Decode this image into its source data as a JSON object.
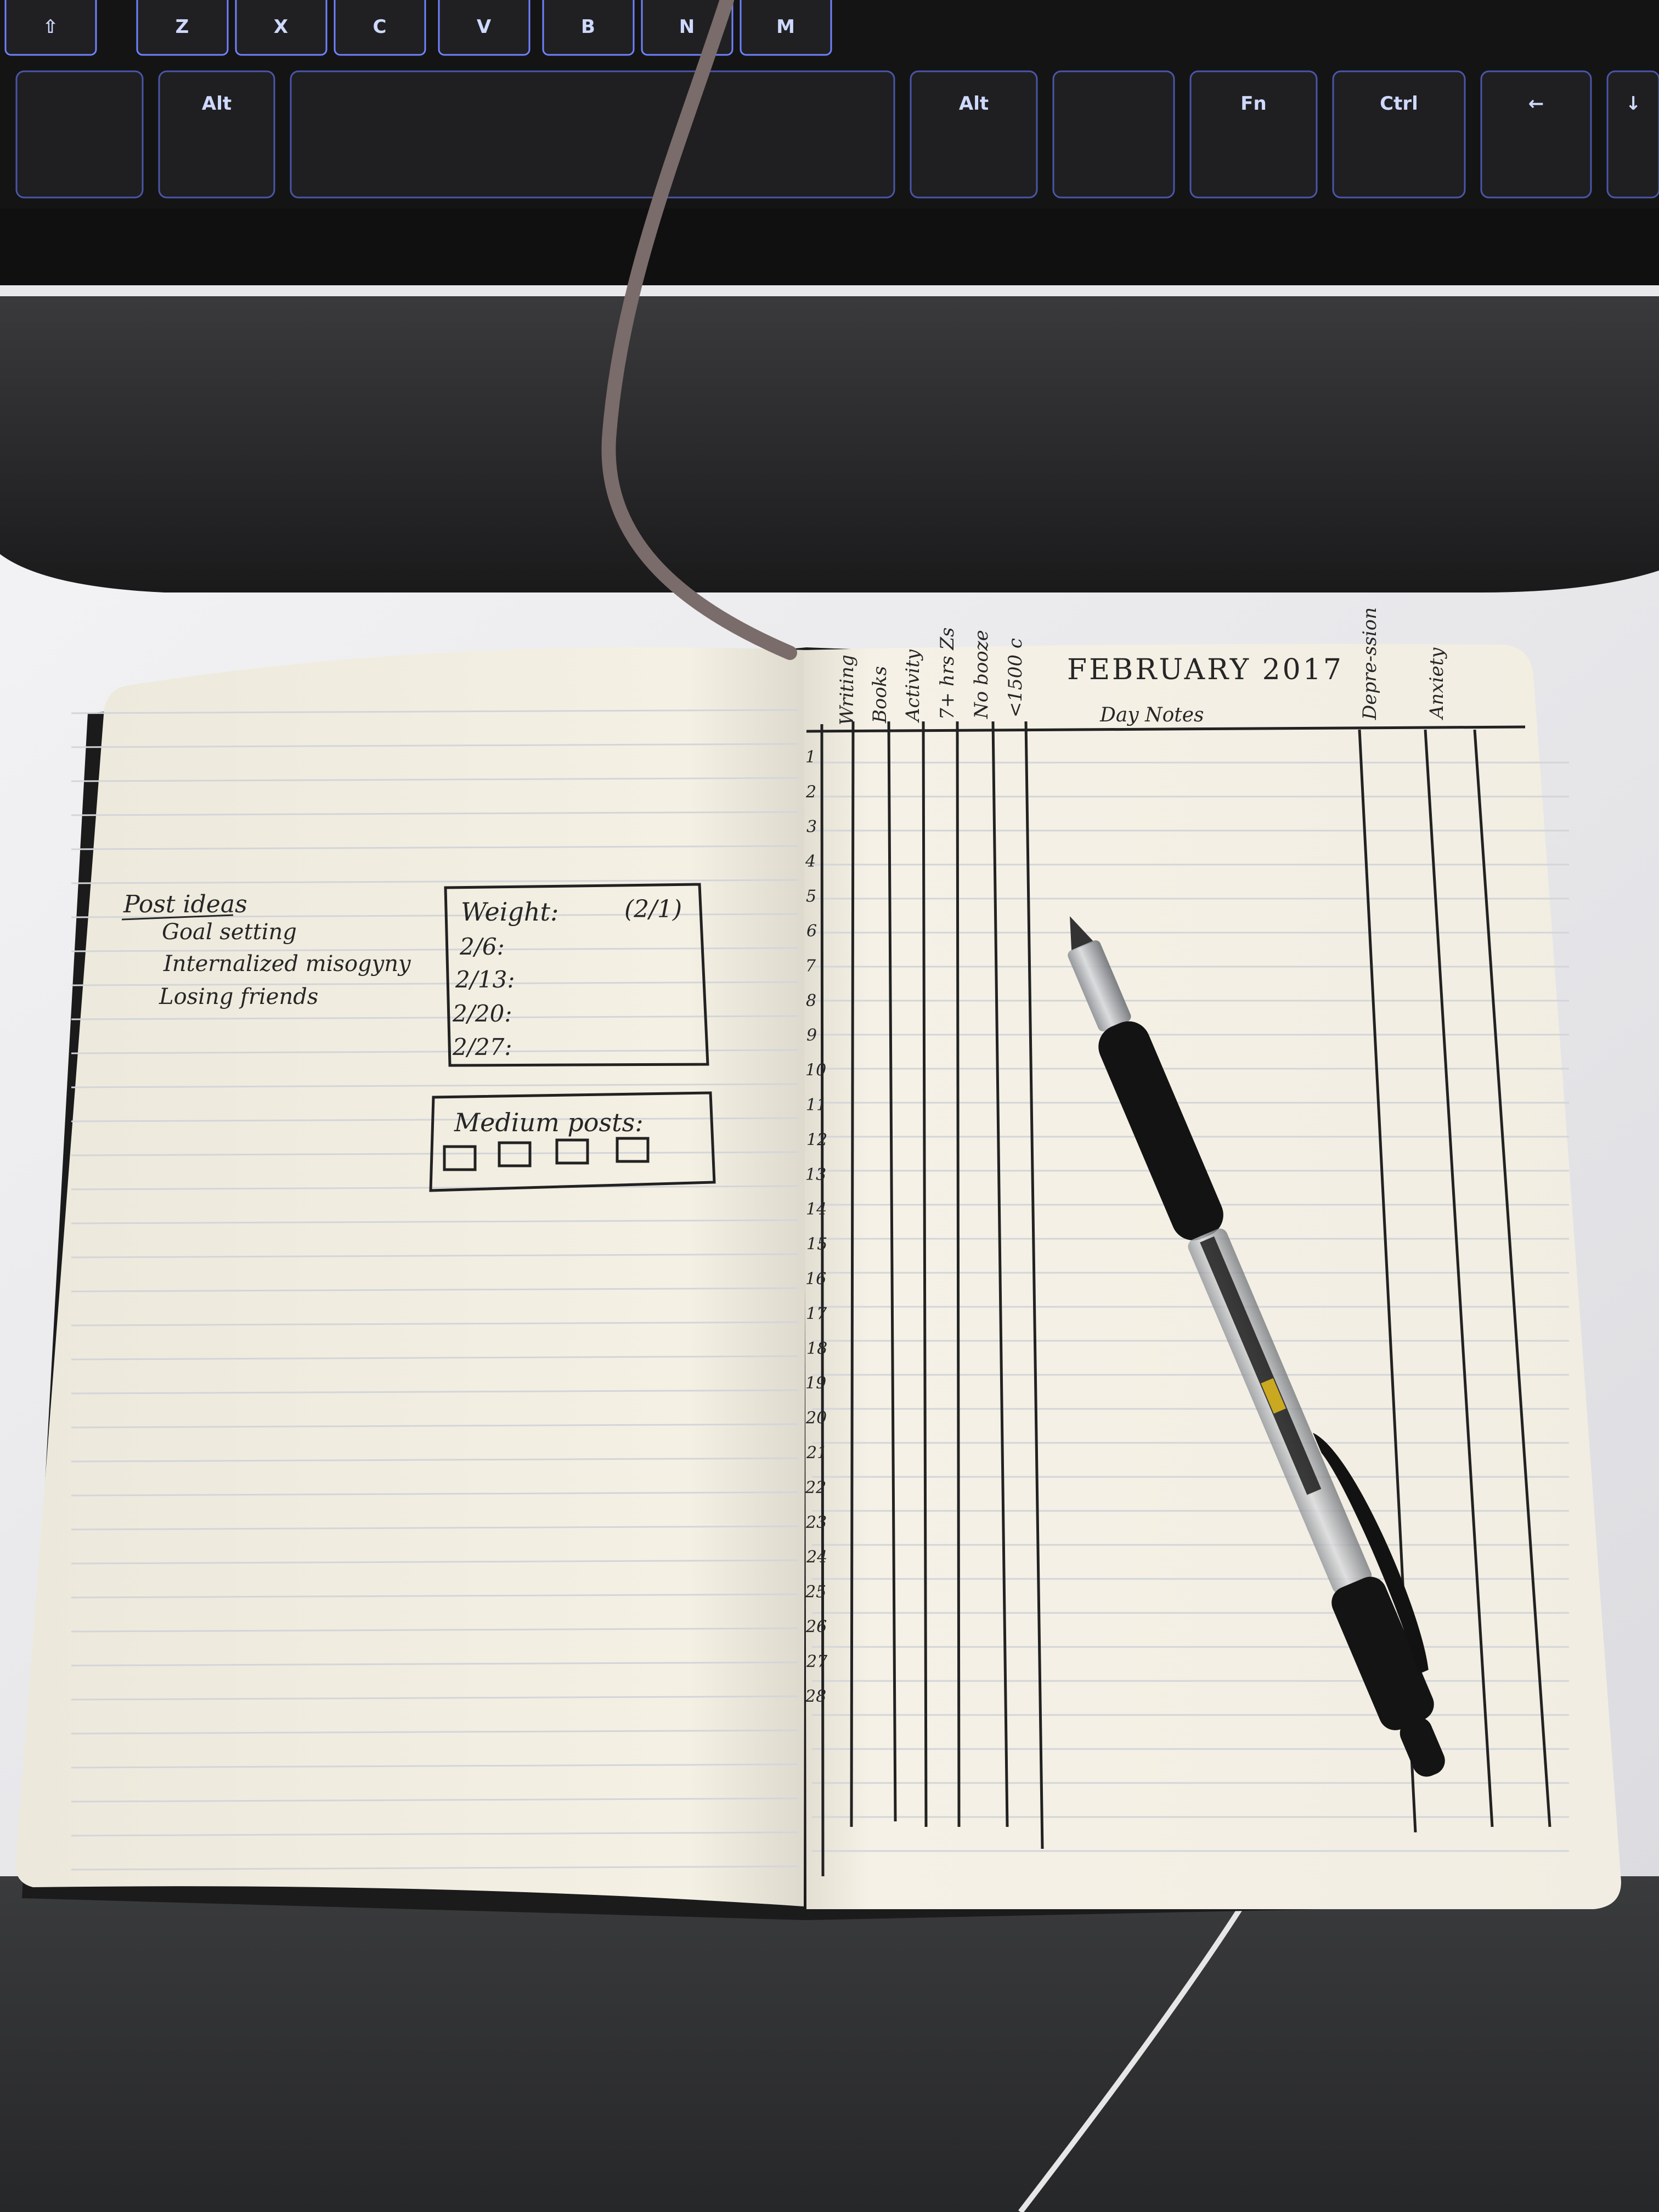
{
  "photo": {
    "description_colors": {
      "desk": "#ececef",
      "keyboard": "#1e1e20",
      "key_glow": "#7a8cff",
      "wrist_rest": "#2b2b2d",
      "paper": "#f4f0e4",
      "rule_line": "#d2d4d8",
      "ink": "#222222",
      "ribbon": "#7c6e6c",
      "floor": "#2c2d2f"
    }
  },
  "keyboard": {
    "top_keys": [
      "⇧",
      "Z",
      "X",
      "C",
      "V",
      "B",
      "N",
      "M"
    ],
    "alt_left": "Alt",
    "alt_right": "Alt",
    "ctrl": "Ctrl",
    "fn": "Fn",
    "arrow_left": "←",
    "arrow_down": "↓"
  },
  "left_page": {
    "post_ideas": {
      "title": "Post ideas",
      "items": [
        "Goal setting",
        "Internalized misogyny",
        "Losing friends"
      ]
    },
    "weight_box": {
      "title": "Weight:",
      "start": "(2/1)",
      "dates": [
        "2/6:",
        "2/13:",
        "2/20:",
        "2/27:"
      ]
    },
    "medium_box": {
      "title": "Medium posts:",
      "checkbox_count": 4
    }
  },
  "right_page": {
    "month_title": "FEBRUARY  2017",
    "day_notes_label": "Day Notes",
    "column_headers": [
      "Writing",
      "Books",
      "Activity",
      "7+ hrs Zs",
      "No booze",
      "<1500 c"
    ],
    "right_headers": [
      "Depre-ssion",
      "Anxiety"
    ],
    "days": [
      "1",
      "2",
      "3",
      "4",
      "5",
      "6",
      "7",
      "8",
      "9",
      "10",
      "11",
      "12",
      "13",
      "14",
      "15",
      "16",
      "17",
      "18",
      "19",
      "20",
      "21",
      "22",
      "23",
      "24",
      "25",
      "26",
      "27",
      "28"
    ]
  },
  "pen": {
    "icon": "gel-pen-icon"
  }
}
